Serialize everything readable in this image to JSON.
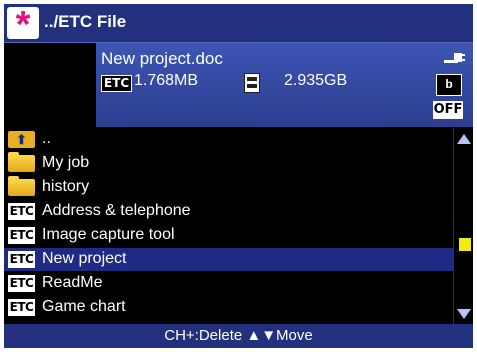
{
  "title": {
    "app_icon_glyph": "*",
    "text": "../ETC File"
  },
  "info": {
    "filename": "New project.doc",
    "etc_badge": "ETC",
    "file_size": "1.768MB",
    "free_space": "2.935GB",
    "camera_badge": "b",
    "off_badge": "OFF"
  },
  "list": {
    "items": [
      {
        "icon": "up-folder-icon",
        "label": ".."
      },
      {
        "icon": "folder-icon",
        "label": "My job"
      },
      {
        "icon": "folder-icon",
        "label": "history"
      },
      {
        "icon": "etc-icon",
        "badge": "ETC",
        "label": "Address & telephone"
      },
      {
        "icon": "etc-icon",
        "badge": "ETC",
        "label": "Image capture tool"
      },
      {
        "icon": "etc-icon",
        "badge": "ETC",
        "label": "New project",
        "selected": true
      },
      {
        "icon": "etc-icon",
        "badge": "ETC",
        "label": "ReadMe"
      },
      {
        "icon": "etc-icon",
        "badge": "ETC",
        "label": "Game chart"
      }
    ]
  },
  "footer": {
    "hint": "CH+:Delete ▲▼Move"
  },
  "colors": {
    "title_bar": "#23307e",
    "selection": "#1e2a84",
    "scroll_thumb": "#f0ec10",
    "accent_magenta": "#e0147a"
  }
}
